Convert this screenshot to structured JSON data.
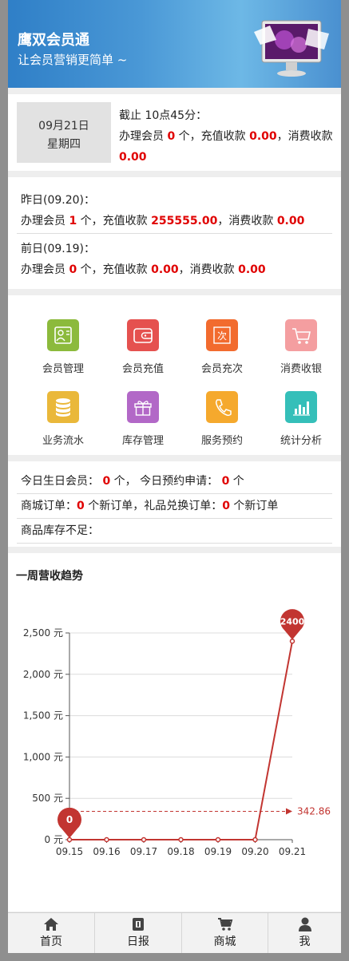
{
  "header": {
    "app_name": "鹰双会员通",
    "slogan": "让会员营销更简单 ~"
  },
  "today": {
    "date": "09月21日",
    "weekday": "星期四",
    "cutoff": "截止 10点45分：",
    "members_prefix": "办理会员",
    "members": "0",
    "members_suffix": "个，充值收款",
    "recharge": "0.00",
    "consume_prefix": "，消费收款",
    "consume": "0.00"
  },
  "history": [
    {
      "label": "昨日(09.20)：",
      "members_prefix": "办理会员",
      "members": "1",
      "members_suffix": "个，充值收款",
      "recharge": "255555.00",
      "consume_prefix": "，消费收款",
      "consume": "0.00"
    },
    {
      "label": "前日(09.19)：",
      "members_prefix": "办理会员",
      "members": "0",
      "members_suffix": "个，充值收款",
      "recharge": "0.00",
      "consume_prefix": "，消费收款",
      "consume": "0.00"
    }
  ],
  "functions": [
    {
      "label": "会员管理",
      "icon": "member-card-icon",
      "color": "#8cba3c"
    },
    {
      "label": "会员充值",
      "icon": "wallet-icon",
      "color": "#e5514f"
    },
    {
      "label": "会员充次",
      "icon": "times-stamp-icon",
      "color": "#f26b2e"
    },
    {
      "label": "消费收银",
      "icon": "cart-icon",
      "color": "#f49ea0"
    },
    {
      "label": "业务流水",
      "icon": "database-icon",
      "color": "#eab83a"
    },
    {
      "label": "库存管理",
      "icon": "gift-icon",
      "color": "#b268c7"
    },
    {
      "label": "服务预约",
      "icon": "phone-service-icon",
      "color": "#f5a92d"
    },
    {
      "label": "统计分析",
      "icon": "bar-chart-icon",
      "color": "#35bfb9"
    }
  ],
  "notices": {
    "birthday_label": "今日生日会员：",
    "birthday_count": "0",
    "birthday_unit": "个，",
    "booking_label": "今日预约申请：",
    "booking_count": "0",
    "booking_unit": "个",
    "mall_label": "商城订单：",
    "mall_count": "0",
    "mall_unit": "个新订单，礼品兑换订单：",
    "gift_count": "0",
    "gift_unit": "个新订单",
    "stock_label": "商品库存不足："
  },
  "chart_section_title": "一周营收趋势",
  "chart_data": {
    "type": "line",
    "title": "",
    "x": [
      "09.15",
      "09.16",
      "09.17",
      "09.18",
      "09.19",
      "09.20",
      "09.21"
    ],
    "series": [
      {
        "values": [
          0,
          0,
          0,
          0,
          0,
          0,
          2400
        ]
      }
    ],
    "ylim": [
      0,
      2500
    ],
    "yticks": [
      0,
      500,
      1000,
      1500,
      2000,
      2500
    ],
    "ytick_labels": [
      "0 元",
      "500 元",
      "1,000 元",
      "1,500 元",
      "2,000 元",
      "2,500 元"
    ],
    "mark_points": [
      {
        "label": "0",
        "x": "09.15",
        "y": 0
      },
      {
        "label": "2400",
        "x": "09.21",
        "y": 2400
      }
    ],
    "mark_line": {
      "label": "342.86",
      "y": 342.86,
      "style": "dashed"
    },
    "grid": true,
    "color": "#c23531"
  },
  "tabbar": [
    {
      "label": "首页",
      "icon": "home-icon"
    },
    {
      "label": "日报",
      "icon": "report-icon"
    },
    {
      "label": "商城",
      "icon": "shop-cart-icon"
    },
    {
      "label": "我",
      "icon": "user-icon"
    }
  ]
}
